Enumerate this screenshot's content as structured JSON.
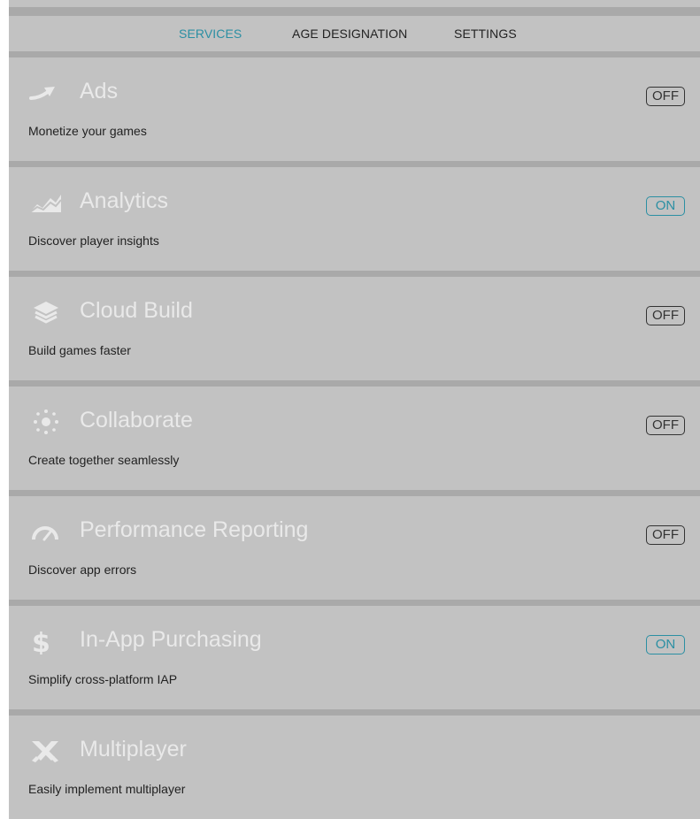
{
  "tabs": [
    {
      "label": "SERVICES",
      "active": true
    },
    {
      "label": "AGE DESIGNATION",
      "active": false
    },
    {
      "label": "SETTINGS",
      "active": false
    }
  ],
  "services": [
    {
      "icon": "ads-icon",
      "title": "Ads",
      "description": "Monetize your games",
      "toggle": "OFF"
    },
    {
      "icon": "analytics-icon",
      "title": "Analytics",
      "description": "Discover player insights",
      "toggle": "ON"
    },
    {
      "icon": "cloud-build-icon",
      "title": "Cloud Build",
      "description": "Build games faster",
      "toggle": "OFF"
    },
    {
      "icon": "collaborate-icon",
      "title": "Collaborate",
      "description": "Create together seamlessly",
      "toggle": "OFF"
    },
    {
      "icon": "performance-reporting-icon",
      "title": "Performance Reporting",
      "description": "Discover app errors",
      "toggle": "OFF"
    },
    {
      "icon": "in-app-purchasing-icon",
      "title": "In-App Purchasing",
      "description": "Simplify cross-platform IAP",
      "toggle": "ON"
    },
    {
      "icon": "multiplayer-icon",
      "title": "Multiplayer",
      "description": "Easily implement multiplayer",
      "toggle": ""
    }
  ],
  "colors": {
    "accent": "#2b8fa3",
    "panel": "#c2c2c2",
    "separator": "#a9a9a9",
    "title": "#e9e9e9"
  }
}
